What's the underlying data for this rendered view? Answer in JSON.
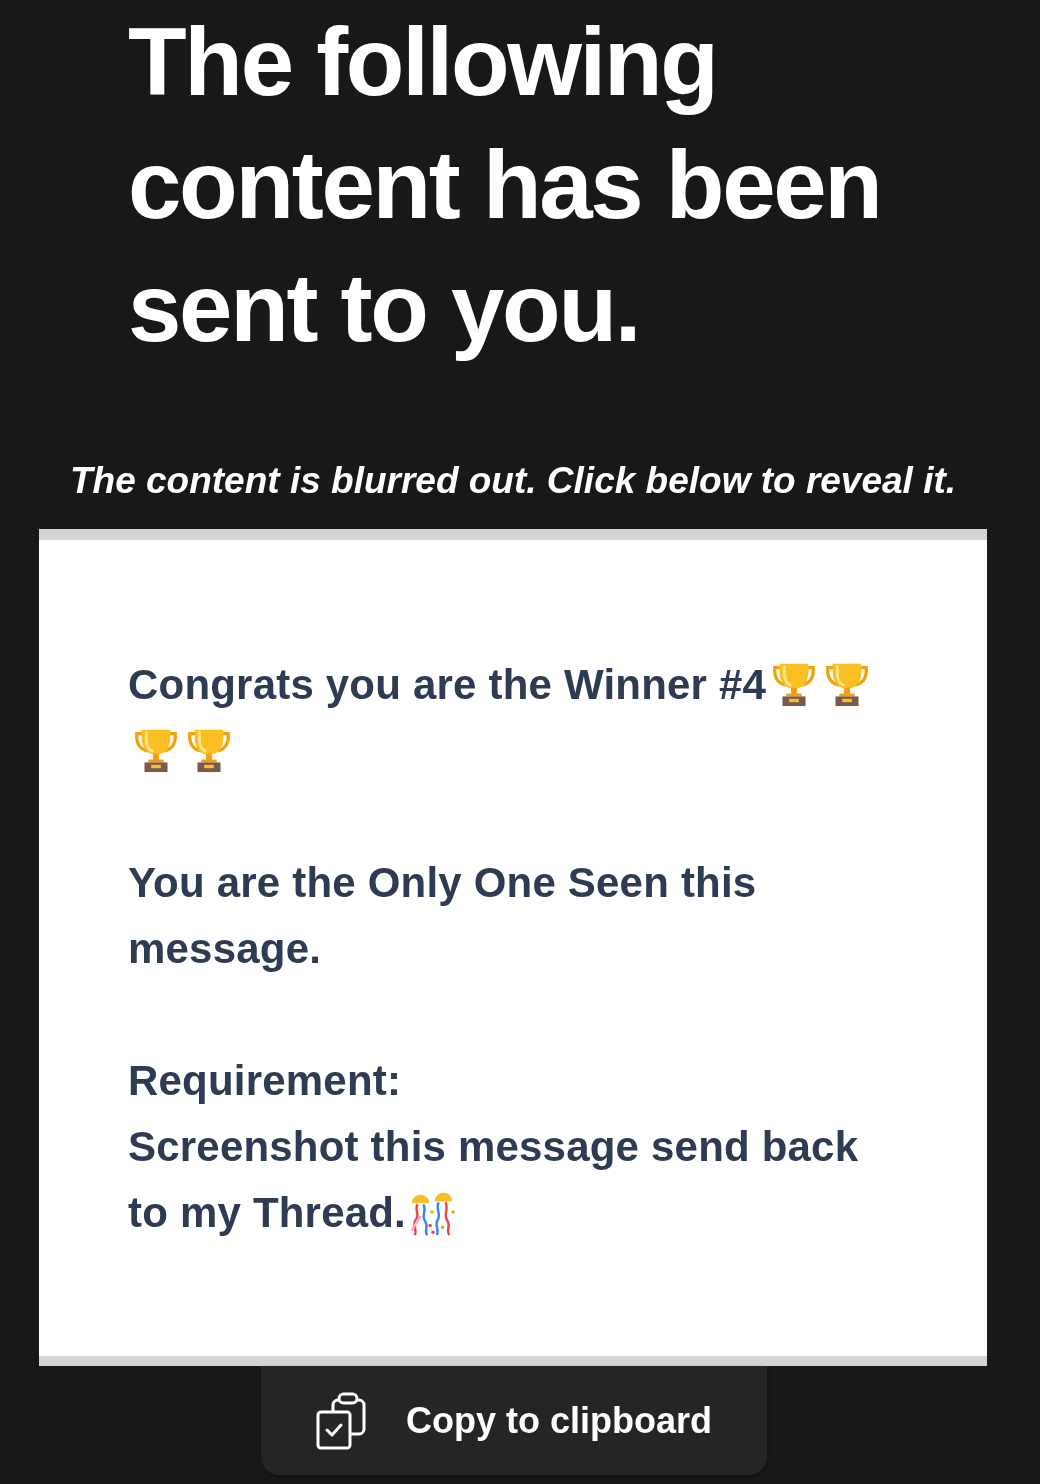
{
  "heading": "The following content has been sent to you.",
  "notice": "The content is blurred out. Click below to reveal it.",
  "message": {
    "paragraphs": [
      {
        "lines": [
          [
            {
              "kind": "text",
              "text": "Congrats you are the Winner #4"
            },
            {
              "kind": "trophy"
            },
            {
              "kind": "trophy"
            },
            {
              "kind": "trophy"
            },
            {
              "kind": "trophy"
            }
          ]
        ]
      },
      {
        "lines": [
          [
            {
              "kind": "text",
              "text": "You are the Only One Seen this message."
            }
          ]
        ]
      },
      {
        "lines": [
          [
            {
              "kind": "text",
              "text": "Requirement:"
            }
          ],
          [
            {
              "kind": "text",
              "text": "Screenshot this message send back"
            }
          ],
          [
            {
              "kind": "text",
              "text": "to my Thread."
            },
            {
              "kind": "confetti"
            }
          ]
        ]
      }
    ]
  },
  "copy_button": {
    "label": "Copy to clipboard"
  }
}
